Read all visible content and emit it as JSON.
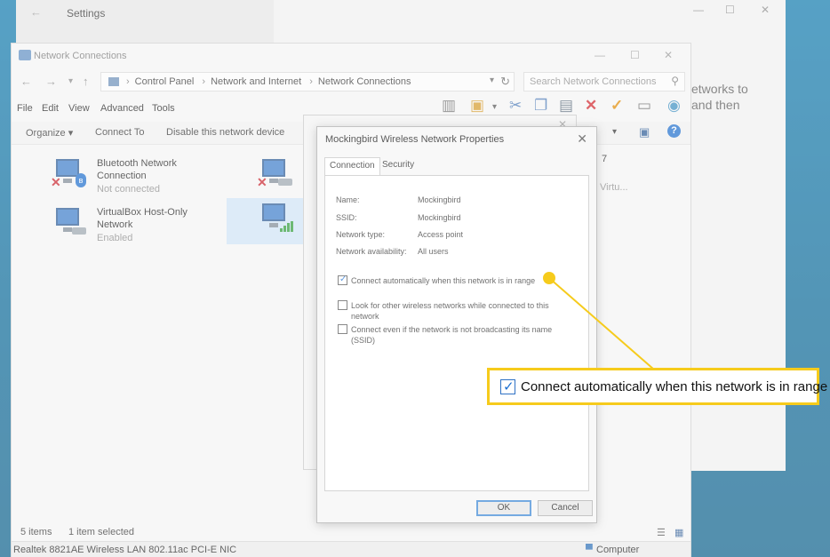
{
  "settings": {
    "title": "Settings",
    "body_line1": "etworks to",
    "body_line2": "and then"
  },
  "network_window": {
    "title": "Network Connections",
    "breadcrumb": [
      "Control Panel",
      "Network and Internet",
      "Network Connections"
    ],
    "search_placeholder": "Search Network Connections",
    "menu": [
      "File",
      "Edit",
      "View",
      "Advanced",
      "Tools"
    ],
    "commands": [
      "Organize ▾",
      "Connect To",
      "Disable this network device"
    ],
    "items": [
      {
        "name_line1": "Bluetooth Network",
        "name_line2": "Connection",
        "status": "Not connected"
      },
      {
        "name_line1": "VirtualBox Host-Only",
        "name_line2": "Network",
        "status": "Enabled"
      }
    ],
    "partial_right_1": "7",
    "partial_right_2": "Virtu...",
    "status_items": "5 items",
    "status_selected": "1 item selected",
    "bottom_left": "Realtek 8821AE Wireless LAN 802.11ac PCI-E NIC",
    "bottom_right": "Computer"
  },
  "dialog": {
    "title": "Mockingbird Wireless Network Properties",
    "tabs": [
      "Connection",
      "Security"
    ],
    "fields": [
      {
        "label": "Name:",
        "value": "Mockingbird"
      },
      {
        "label": "SSID:",
        "value": "Mockingbird"
      },
      {
        "label": "Network type:",
        "value": "Access point"
      },
      {
        "label": "Network availability:",
        "value": "All users"
      }
    ],
    "checkboxes": [
      {
        "label": "Connect automatically when this network is in range",
        "checked": true
      },
      {
        "label": "Look for other wireless networks while connected to this network",
        "checked": false
      },
      {
        "label": "Connect even if the network is not broadcasting its name (SSID)",
        "checked": false
      }
    ],
    "ok_label": "OK",
    "cancel_label": "Cancel"
  },
  "callout": {
    "text": "Connect automatically when this network is in range",
    "color": "#f6cb1c"
  }
}
